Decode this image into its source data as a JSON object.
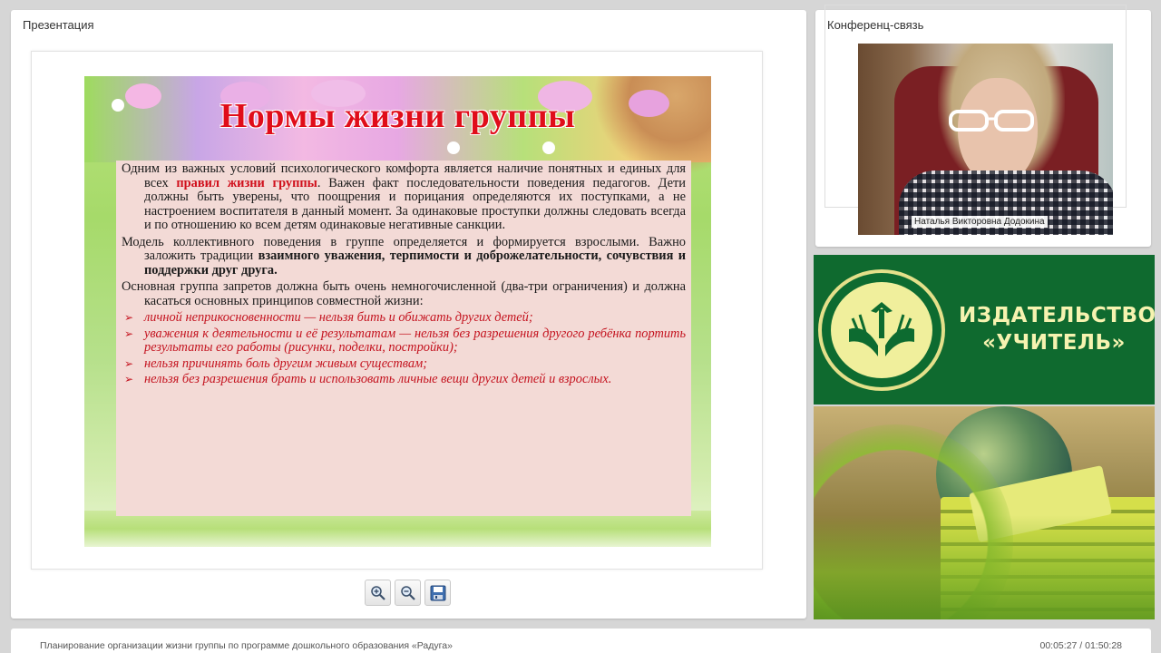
{
  "presentation_panel": {
    "title": "Презентация",
    "slide": {
      "title": "Нормы жизни группы",
      "paragraph1": {
        "text_before": "Одним из важных условий психологического комфорта является наличие понятных и единых для всех ",
        "highlight": "правил жизни группы",
        "text_after": ". Важен факт последовательности поведения педагогов. Дети должны быть уверены, что поощрения и порицания определяются их поступками, а не настроением воспитателя в данный момент. За одинаковые проступки должны следовать всегда и по отношению ко всем детям одинаковые негативные санкции."
      },
      "paragraph2": {
        "text_before": "Модель коллективного поведения в группе определяется и формируется взрослыми. Важно заложить традиции ",
        "bold": "взаимного уважения, терпимости и доброжелательности, сочувствия и поддержки друг друга."
      },
      "paragraph3": "Основная группа запретов должна быть очень немногочисленной (два-три ограничения) и должна касаться основных принципов совместной жизни:",
      "bullets": [
        "личной неприкосновенности — нельзя бить и обижать других детей;",
        "уважения к деятельности и её результатам — нельзя без разрешения другого ребёнка портить результаты его работы (рисунки, поделки, постройки);",
        "нельзя причинять боль другим живым существам;",
        "нельзя без разрешения брать и использовать личные вещи других детей и взрослых."
      ]
    },
    "toolbar": {
      "zoom_in_icon": "zoom-in-icon",
      "zoom_out_icon": "zoom-out-icon",
      "save_icon": "floppy-disk-icon"
    }
  },
  "conference_panel": {
    "title": "Конференц-связь",
    "speaker_name": "Наталья Викторовна Додокина"
  },
  "ad_banner": {
    "line1": "ИЗДАТЕЛЬСТВО",
    "line2": "«УЧИТЕЛЬ»"
  },
  "footer": {
    "webinar_title": "Планирование организации жизни группы по программе дошкольного образования «Радуга»",
    "time": "00:05:27 / 01:50:28"
  },
  "colors": {
    "title_red": "#e00d1a",
    "bullet_red": "#c4131f",
    "ad_green": "#0f6a2f",
    "ad_text": "#f6f3b0"
  }
}
